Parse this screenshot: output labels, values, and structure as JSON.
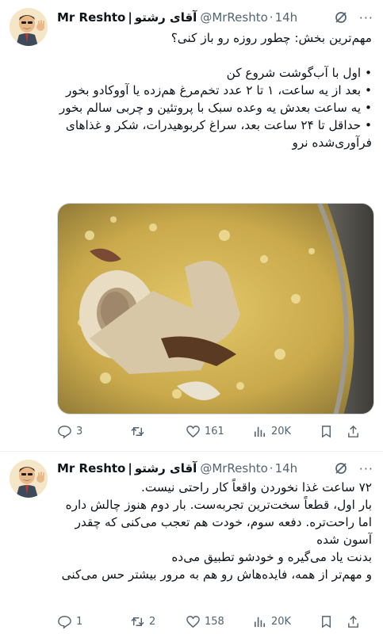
{
  "tweets": [
    {
      "display_name_en": "Mr Reshto",
      "display_name_fa": "آقای رشتو",
      "separator": "|",
      "handle": "@MrReshto",
      "dot": "·",
      "time": "14h",
      "more": "···",
      "lines": [
        "مهم‌ترین بخش: چطور روزه رو باز کنی؟",
        "",
        "• اول با آب‌گوشت شروع کن",
        "• بعد از یه ساعت، ۱ تا ۲ عدد تخم‌مرغ هم‌زده یا آووکادو بخور",
        "• یه ساعت بعدش یه وعده سبک با پروتئین و چربی سالم بخور",
        "• حداقل تا ۲۴ ساعت بعد، سراغ کربوهیدرات، شکر و غذاهای فرآوری‌شده نرو"
      ],
      "media": {
        "subject": "bone broth with marrow bone in pot"
      },
      "actions": {
        "replies": "3",
        "retweets": "",
        "likes": "161",
        "views": "20K"
      }
    },
    {
      "display_name_en": "Mr Reshto",
      "display_name_fa": "آقای رشتو",
      "separator": "|",
      "handle": "@MrReshto",
      "dot": "·",
      "time": "14h",
      "more": "···",
      "lines": [
        "۷۲ ساعت غذا نخوردن واقعاً کار راحتی نیست.",
        "بار اول، قطعاً سخت‌ترین تجربه‌ست. بار دوم هنوز چالش داره اما راحت‌تره. دفعه سوم، خودت هم تعجب می‌کنی که چقدر آسون شده",
        "بدنت یاد می‌گیره و خودشو تطبیق می‌ده",
        "و مهم‌تر از همه، فایده‌هاش رو هم به مرور بیشتر حس می‌کنی"
      ],
      "actions": {
        "replies": "1",
        "retweets": "2",
        "likes": "158",
        "views": "20K"
      }
    }
  ],
  "colors": {
    "text": "#0f1419",
    "muted": "#536471",
    "border": "#eff3f4",
    "thread": "#cfd9de"
  }
}
